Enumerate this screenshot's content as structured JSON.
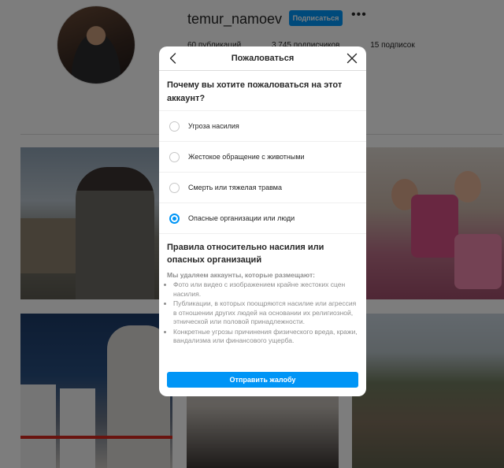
{
  "profile": {
    "username": "temur_namoev",
    "follow_label": "Подписаться",
    "more_icon": "more-dots-icon",
    "stats": {
      "posts": "60 публикаций",
      "followers": "3 745 подписчиков",
      "following": "15 подписок"
    }
  },
  "dialog": {
    "title": "Пожаловаться",
    "back_icon": "chevron-left-icon",
    "close_icon": "close-icon",
    "question": "Почему вы хотите пожаловаться на этот аккаунт?",
    "options": [
      {
        "label": "Угроза насилия",
        "checked": false
      },
      {
        "label": "Жестокое обращение с животными",
        "checked": false
      },
      {
        "label": "Смерть или тяжелая травма",
        "checked": false
      },
      {
        "label": "Опасные организации или люди",
        "checked": true
      }
    ],
    "policy_title": "Правила относительно насилия или опасных организаций",
    "policy_subtitle": "Мы удаляем аккаунты, которые размещают:",
    "policy_items": [
      "Фото или видео с изображением крайне жестоких сцен насилия.",
      "Публикации, в которых поощряются насилие или агрессия в отношении других людей на основании их религиозной, этнической или половой принадлежности.",
      "Конкретные угрозы причинения физического вреда, кражи, вандализма или финансового ущерба."
    ],
    "submit_label": "Отправить жалобу"
  },
  "colors": {
    "accent": "#0095f6",
    "overlay": "rgba(0,0,0,0.5)"
  }
}
